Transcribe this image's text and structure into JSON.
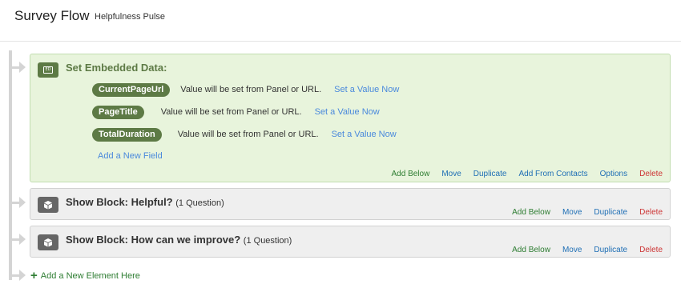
{
  "header": {
    "title": "Survey Flow",
    "subtitle": "Helpfulness Pulse"
  },
  "embedded_data": {
    "title": "Set Embedded Data:",
    "icon": "embedded-data-icon",
    "icon_label": "ED",
    "fields": [
      {
        "name": "CurrentPageUrl",
        "value_text": "Value will be set from Panel or URL.",
        "link": "Set a Value Now"
      },
      {
        "name": "PageTitle",
        "value_text": "Value will be set from Panel or URL.",
        "link": "Set a Value Now"
      },
      {
        "name": "TotalDuration",
        "value_text": "Value will be set from Panel or URL.",
        "link": "Set a Value Now"
      }
    ],
    "add_field": "Add a New Field",
    "actions": {
      "add_below": "Add Below",
      "move": "Move",
      "duplicate": "Duplicate",
      "add_from_contacts": "Add From Contacts",
      "options": "Options",
      "delete": "Delete"
    }
  },
  "blocks": [
    {
      "prefix": "Show Block: ",
      "name": "Helpful?",
      "count": "(1 Question)",
      "actions": {
        "add_below": "Add Below",
        "move": "Move",
        "duplicate": "Duplicate",
        "delete": "Delete"
      }
    },
    {
      "prefix": "Show Block: ",
      "name": "How can we improve?",
      "count": "(1 Question)",
      "actions": {
        "add_below": "Add Below",
        "move": "Move",
        "duplicate": "Duplicate",
        "delete": "Delete"
      }
    }
  ],
  "add_element": {
    "icon": "plus-icon",
    "label": "Add a New Element Here"
  },
  "colors": {
    "embedded_bg": "#e8f4dc",
    "embedded_accent": "#5d7a45",
    "link_blue": "#4a89dc",
    "action_green": "#2e7d32",
    "action_blue": "#1f6fb5",
    "action_red": "#cc3333",
    "block_bg": "#efefef"
  }
}
